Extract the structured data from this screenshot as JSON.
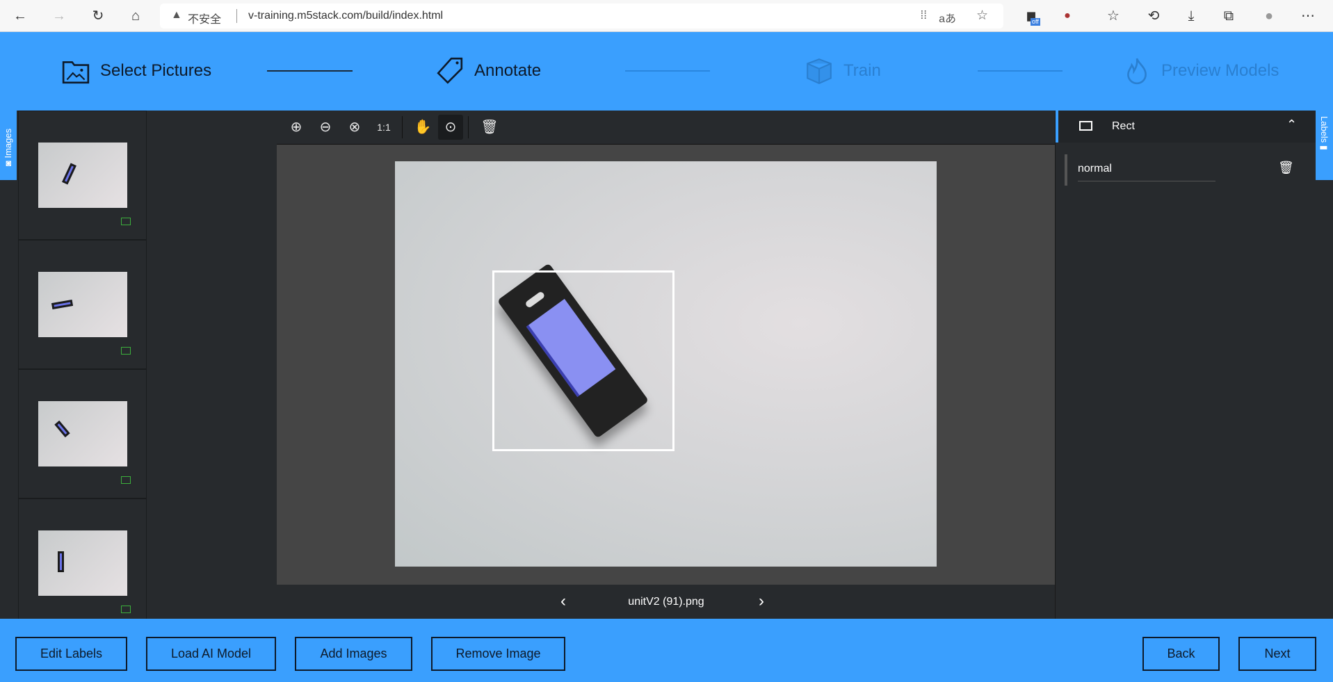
{
  "browser": {
    "security_label": "不安全",
    "url": "v-training.m5stack.com/build/index.html",
    "ext_badge": "off"
  },
  "steps": [
    {
      "label": "Select Pictures",
      "state": "done"
    },
    {
      "label": "Annotate",
      "state": "active"
    },
    {
      "label": "Train",
      "state": "pending"
    },
    {
      "label": "Preview Models",
      "state": "pending"
    }
  ],
  "side_tabs": {
    "left": "Images",
    "right": "Labels"
  },
  "thumbnails": [
    {
      "name": "thumb-1"
    },
    {
      "name": "thumb-2"
    },
    {
      "name": "thumb-3"
    },
    {
      "name": "thumb-4"
    }
  ],
  "toolbar": {
    "tools": [
      "zoom-in",
      "zoom-out",
      "zoom-fit",
      "zoom-actual",
      "pan",
      "select",
      "delete"
    ],
    "active_tool": "select"
  },
  "viewer": {
    "filename": "unitV2 (91).png"
  },
  "label_panel": {
    "type": "Rect",
    "labels": [
      {
        "name": "normal"
      }
    ]
  },
  "footer": {
    "edit_labels": "Edit Labels",
    "load_model": "Load AI Model",
    "add_images": "Add Images",
    "remove_image": "Remove Image",
    "back": "Back",
    "next": "Next"
  },
  "colors": {
    "accent": "#3a9ffe",
    "panel": "#272a2d",
    "bbox": "#ffffff"
  }
}
